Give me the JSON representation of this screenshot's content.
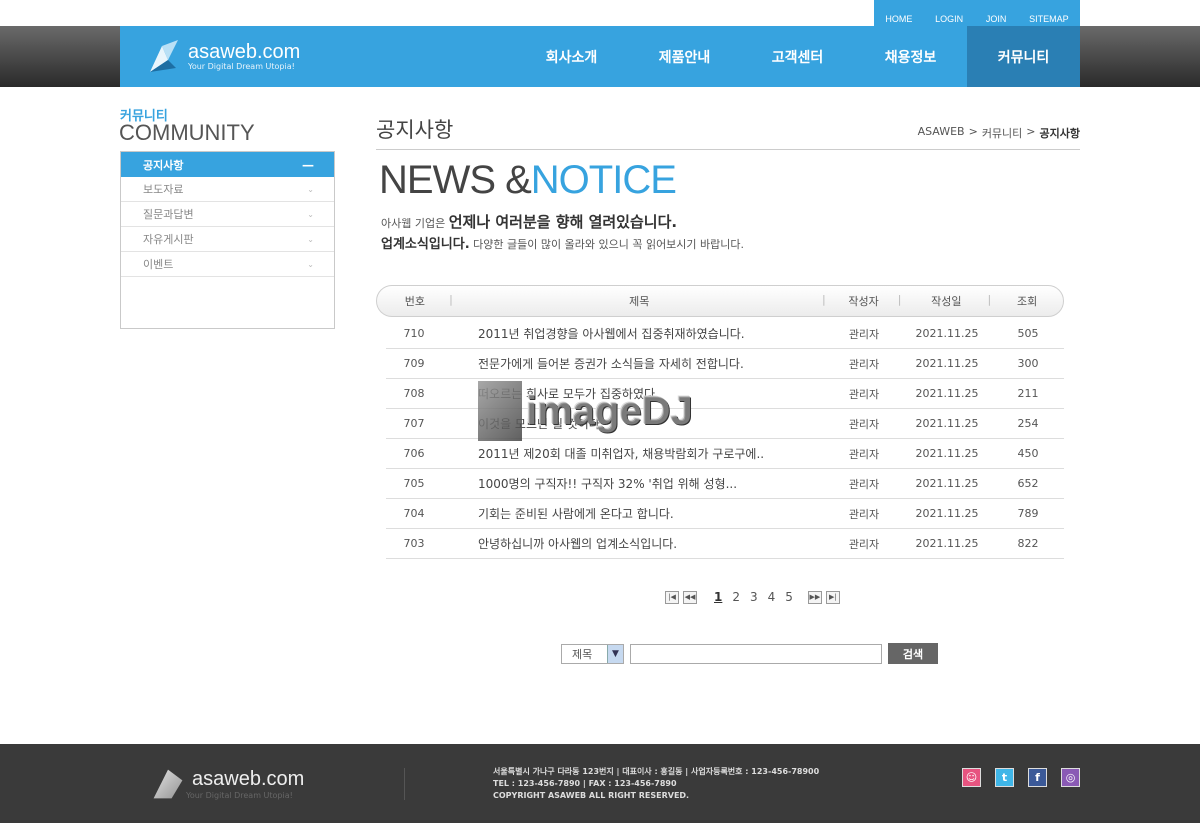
{
  "util": [
    "HOME",
    "LOGIN",
    "JOIN",
    "SITEMAP"
  ],
  "logo": {
    "name": "asaweb",
    "domain": ".com",
    "tagline": "Your Digital Dream Utopia!"
  },
  "gnb": [
    "회사소개",
    "제품안내",
    "고객센터",
    "채용정보",
    "커뮤니티"
  ],
  "sidebar": {
    "title_ko": "커뮤니티",
    "title_en": "COMMUNITY",
    "items": [
      {
        "label": "공지사항",
        "active": true
      },
      {
        "label": "보도자료"
      },
      {
        "label": "질문과답변"
      },
      {
        "label": "자유게시판"
      },
      {
        "label": "이벤트"
      }
    ]
  },
  "page": {
    "title": "공지사항",
    "breadcrumb": [
      "ASAWEB",
      "커뮤니티",
      "공지사항"
    ],
    "heading_a": "NEWS &",
    "heading_b": "NOTICE",
    "intro1_small": "아사웹 기업은 ",
    "intro1_big": "언제나 여러분을 향해 열려있습니다.",
    "intro2_big": "업계소식입니다.",
    "intro2_small": " 다양한 글들이 많이 올라와 있으니 꼭 읽어보시기 바랍니다."
  },
  "table": {
    "headers": [
      "번호",
      "제목",
      "작성자",
      "작성일",
      "조회"
    ],
    "rows": [
      {
        "no": "710",
        "title": "2011년 취업경향을 아사웹에서 집중취재하였습니다.",
        "writer": "관리자",
        "date": "2021.11.25",
        "views": "505"
      },
      {
        "no": "709",
        "title": "전문가에게 들어본 증권가 소식들을 자세히 전합니다.",
        "writer": "관리자",
        "date": "2021.11.25",
        "views": "300"
      },
      {
        "no": "708",
        "title": "떠오르는 회사로 모두가 집중하였다",
        "writer": "관리자",
        "date": "2021.11.25",
        "views": "211"
      },
      {
        "no": "707",
        "title": "이것을 모르면 될 것이다",
        "writer": "관리자",
        "date": "2021.11.25",
        "views": "254"
      },
      {
        "no": "706",
        "title": "2011년 제20회 대졸 미취업자, 채용박람회가 구로구에..",
        "writer": "관리자",
        "date": "2021.11.25",
        "views": "450"
      },
      {
        "no": "705",
        "title": "1000명의 구직자!! 구직자 32% '취업 위해 성형...",
        "writer": "관리자",
        "date": "2021.11.25",
        "views": "652"
      },
      {
        "no": "704",
        "title": "기회는 준비된 사람에게 온다고 합니다.",
        "writer": "관리자",
        "date": "2021.11.25",
        "views": "789"
      },
      {
        "no": "703",
        "title": "안녕하십니까 아사웹의 업계소식입니다.",
        "writer": "관리자",
        "date": "2021.11.25",
        "views": "822"
      }
    ]
  },
  "pager": {
    "pages": [
      "1",
      "2",
      "3",
      "4",
      "5"
    ],
    "current": "1"
  },
  "search": {
    "option": "제목",
    "button": "검색",
    "value": ""
  },
  "watermark": "imageDJ",
  "footer": {
    "line1": "서울특별시 가나구 다라동 123번지  |  대표이사 : 홍길동  |  사업자등록번호 : 123-456-78900",
    "line2": "TEL : 123-456-7890  |  FAX : 123-456-7890",
    "line3": "COPYRIGHT ASAWEB ALL RIGHT RESERVED.",
    "sns": [
      "cyworld-icon",
      "twitter-icon",
      "facebook-icon",
      "me2day-icon"
    ]
  },
  "colors": {
    "accent": "#37a3df",
    "active_menu": "#2a7fb4",
    "footer_bg": "#3a3a3a"
  }
}
